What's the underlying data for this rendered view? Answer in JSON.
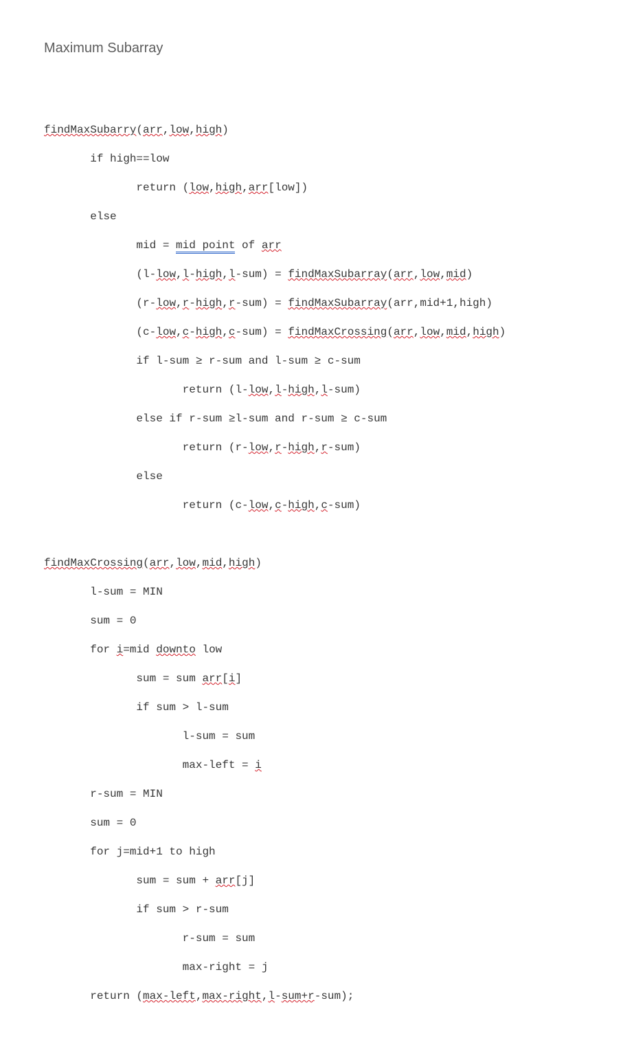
{
  "title": "Maximum Subarray",
  "code": {
    "l1": {
      "a": "findMaxSubarry",
      "b": "(",
      "c": "arr",
      "d": ",",
      "e": "low",
      "f": ",",
      "g": "high",
      "h": ")"
    },
    "l2": {
      "a": "       if high==low"
    },
    "l3": {
      "a": "              return (",
      "b": "low",
      "c": ",",
      "d": "high",
      "e": ",",
      "f": "arr",
      "g": "[low])"
    },
    "l4": {
      "a": "       else"
    },
    "l5": {
      "a": "              mid = ",
      "b": "mid point",
      "c": " of ",
      "d": "arr"
    },
    "l6": {
      "a": "              (l-",
      "b": "low",
      "c": ",",
      "d": "l",
      "e": "-",
      "f": "high",
      "g": ",",
      "h": "l",
      "i": "-sum) = ",
      "j": "findMaxSubarray",
      "k": "(",
      "l": "arr",
      "m": ",",
      "n": "low",
      "o": ",",
      "p": "mid",
      "q": ")"
    },
    "l7": {
      "a": "              (r-",
      "b": "low",
      "c": ",",
      "d": "r",
      "e": "-",
      "f": "high",
      "g": ",",
      "h": "r",
      "i": "-sum) = ",
      "j": "findMaxSubarray",
      "k": "(arr,mid+1,high)"
    },
    "l8": {
      "a": "              (c-",
      "b": "low",
      "c": ",",
      "d": "c",
      "e": "-",
      "f": "high",
      "g": ",",
      "h": "c",
      "i": "-sum) = ",
      "j": "findMaxCrossing",
      "k": "(",
      "l": "arr",
      "m": ",",
      "n": "low",
      "o": ",",
      "p": "mid",
      "q": ",",
      "r": "high",
      "s": ")"
    },
    "l9": {
      "a": "              if l-sum ≥ r-sum and l-sum ≥ c-sum"
    },
    "l10": {
      "a": "                     return (l-",
      "b": "low",
      "c": ",",
      "d": "l",
      "e": "-",
      "f": "high",
      "g": ",",
      "h": "l",
      "i": "-sum)"
    },
    "l11": {
      "a": "              else if r-sum ≥l-sum and r-sum ≥ c-sum"
    },
    "l12": {
      "a": "                     return (r-",
      "b": "low",
      "c": ",",
      "d": "r",
      "e": "-",
      "f": "high",
      "g": ",",
      "h": "r",
      "i": "-sum)"
    },
    "l13": {
      "a": "              else"
    },
    "l14": {
      "a": "                     return (c-",
      "b": "low",
      "c": ",",
      "d": "c",
      "e": "-",
      "f": "high",
      "g": ",",
      "h": "c",
      "i": "-sum)"
    },
    "l15": {
      "a": "findMaxCrossing",
      "b": "(",
      "c": "arr",
      "d": ",",
      "e": "low",
      "f": ",",
      "g": "mid",
      "h": ",",
      "i": "high",
      "j": ")"
    },
    "l16": {
      "a": "       l-sum = MIN"
    },
    "l17": {
      "a": "       sum = 0"
    },
    "l18": {
      "a": "       for ",
      "b": "i",
      "c": "=mid ",
      "d": "downto",
      "e": " low"
    },
    "l19": {
      "a": "              sum = sum ",
      "b": "arr",
      "c": "[",
      "d": "i",
      "e": "]"
    },
    "l20": {
      "a": "              if sum > l-sum"
    },
    "l21": {
      "a": "                     l-sum = sum"
    },
    "l22": {
      "a": "                     max-left = ",
      "b": "i"
    },
    "l23": {
      "a": "       r-sum = MIN"
    },
    "l24": {
      "a": "       sum = 0"
    },
    "l25": {
      "a": "       for j=mid+1 to high"
    },
    "l26": {
      "a": "              sum = sum + ",
      "b": "arr",
      "c": "[j]"
    },
    "l27": {
      "a": "              if sum > r-sum"
    },
    "l28": {
      "a": "                     r-sum = sum"
    },
    "l29": {
      "a": "                     max-right = j"
    },
    "l30": {
      "a": "       return (",
      "b": "max-left",
      "c": ",",
      "d": "max-right",
      "e": ",",
      "f": "l",
      "g": "-",
      "h": "sum+r",
      "i": "-sum);"
    }
  }
}
